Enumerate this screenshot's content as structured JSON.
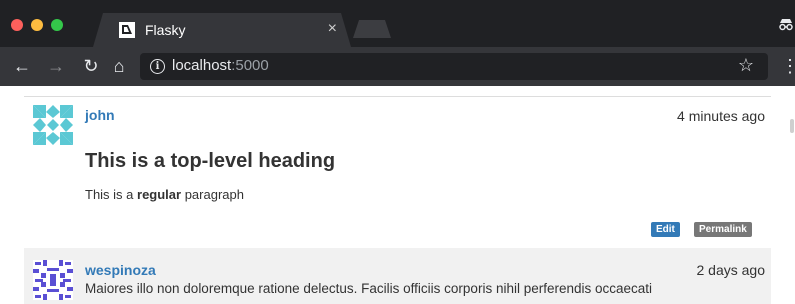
{
  "browser": {
    "tab_title": "Flasky",
    "tab_close": "×",
    "url_host": "localhost",
    "url_port": ":5000",
    "star": "☆",
    "menu": "⋮"
  },
  "posts": [
    {
      "author": "john",
      "date": "4 minutes ago",
      "heading": "This is a top-level heading",
      "para_before": "This is a ",
      "para_bold": "regular",
      "para_after": " paragraph",
      "edit_label": "Edit",
      "permalink_label": "Permalink"
    },
    {
      "author": "wespinoza",
      "date": "2 days ago",
      "body": "Maiores illo non doloremque ratione delectus. Facilis officiis corporis nihil perferendis occaecati"
    }
  ],
  "colors": {
    "link": "#337ab7",
    "edit_badge": "#337ab7",
    "permalink_badge": "#777777",
    "avatar1": "#5bc8d4",
    "avatar2": "#5a4fd4"
  },
  "icons": [
    "back-arrow-icon",
    "forward-arrow-icon",
    "reload-icon",
    "home-icon",
    "info-icon",
    "star-icon",
    "incognito-icon"
  ]
}
